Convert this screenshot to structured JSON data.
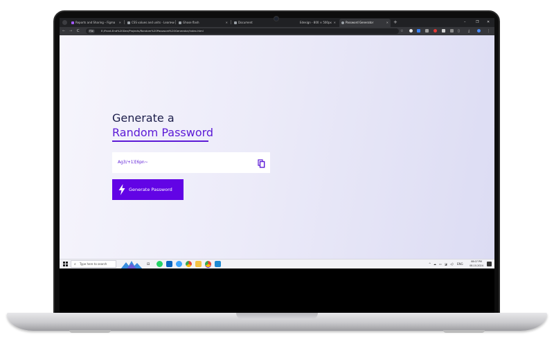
{
  "browser": {
    "tabs": [
      {
        "title": "Reports and Sharing – Figma",
        "favicon_color": "#a259ff",
        "active": false
      },
      {
        "title": "CSS values and units - Learn w",
        "favicon_color": "#9aa0a6",
        "active": false
      },
      {
        "title": "Ghose flash",
        "favicon_color": "#9aa0a6",
        "active": false
      },
      {
        "title": "Document",
        "favicon_color": "#9aa0a6",
        "active": false
      },
      {
        "title": "Edesign - 800 × 500px",
        "favicon_color": "#9aa0a6",
        "active": false
      },
      {
        "title": "Password Generator",
        "favicon_color": "#9aa0a6",
        "active": true
      }
    ],
    "new_tab_label": "+",
    "window_controls": {
      "minimize": "–",
      "maximize": "❐",
      "close": "✕"
    },
    "nav": {
      "back": "←",
      "forward": "→",
      "reload": "C"
    },
    "site_info_label": "File",
    "url": "E:/Front-End%20Dev/Projects/Random%20Password%20Generator/index.html"
  },
  "page": {
    "heading_line1": "Generate a",
    "heading_line2": "Random Password",
    "password_value": "Ag3/+1)[6pn~",
    "generate_button_label": "Generate Password",
    "accent_color": "#6204e5"
  },
  "taskbar": {
    "search_placeholder": "Type here to search",
    "language": "ENG",
    "time": "08:07 PM",
    "date": "08-10-2024"
  }
}
